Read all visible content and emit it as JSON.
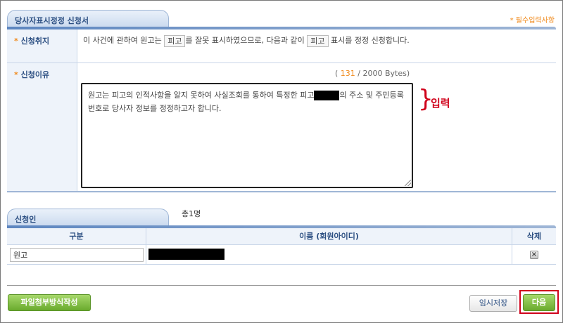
{
  "section1": {
    "title": "당사자표시정정 신청서",
    "required_note": "* 필수입력사항"
  },
  "purpose": {
    "label": "신청취지",
    "text_1": "이 사건에 관하여 원고는",
    "box_1": "피고",
    "text_2": "를 잘못 표시하였으므로, 다음과 같이",
    "box_2": "피고",
    "text_3": "표시를 정정 신청합니다."
  },
  "reason": {
    "label": "신청이유",
    "count_open": "( ",
    "count_value": "131",
    "count_close": " / 2000 Bytes)",
    "text_a": "원고는 피고의 인적사항을 알지 못하여 사실조회를 통하여 특정한 피고",
    "text_b": "의 주소 및 주민등록번호로 당사자 정보를 정정하고자 합니다."
  },
  "annotation": {
    "brace": "}",
    "label": "입력"
  },
  "section2": {
    "title": "신청인",
    "count": "총1명"
  },
  "applicants": {
    "columns": [
      "구분",
      "이름 (회원아이디)",
      "삭제"
    ],
    "rows": [
      {
        "type": "원고"
      }
    ]
  },
  "buttons": {
    "attach": "파일첨부방식작성",
    "temp_save": "임시저장",
    "next": "다음"
  },
  "colors": {
    "accent": "#2c4f82",
    "required": "#f08a1c",
    "highlight": "#d0021b",
    "green": "#6aab2e"
  },
  "icons": {
    "delete": "close-x-icon"
  }
}
